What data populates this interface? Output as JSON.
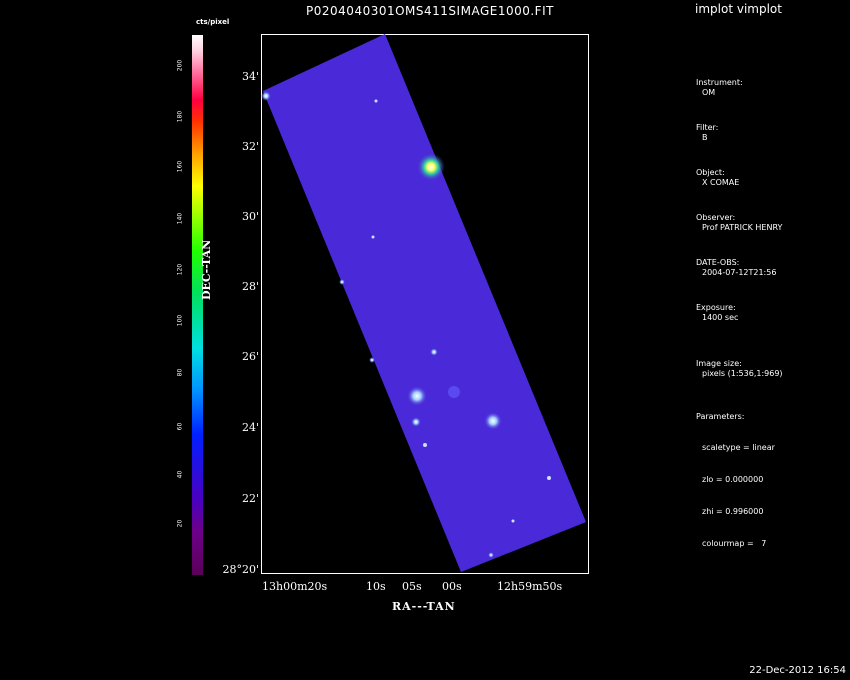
{
  "app": {
    "title": "implot vimplot"
  },
  "plot": {
    "filename": "P0204040301OMS411SIMAGE1000.FIT",
    "xlabel": "RA---TAN",
    "ylabel": "DEC--TAN",
    "colorbar": {
      "unit": "cts/pixel",
      "ticks": [
        "20",
        "40",
        "60",
        "80",
        "100",
        "120",
        "140",
        "160",
        "180",
        "200"
      ]
    },
    "yticks": [
      "28°20'",
      "22'",
      "24'",
      "26'",
      "28'",
      "30'",
      "32'",
      "34'"
    ],
    "xticks": [
      "13h00m20s",
      "10s",
      "05s",
      "00s",
      "12h59m50s"
    ]
  },
  "info": {
    "instrument_label": "Instrument:",
    "instrument": "OM",
    "filter_label": "Filter:",
    "filter": "B",
    "object_label": "Object:",
    "object": "X COMAE",
    "observer_label": "Observer:",
    "observer": "Prof PATRICK HENRY",
    "dateobs_label": "DATE-OBS:",
    "dateobs": "2004-07-12T21:56",
    "exposure_label": "Exposure:",
    "exposure": "1400 sec",
    "imagesize_label": "Image size:",
    "imagesize": "pixels (1:536,1:969)",
    "params_label": "Parameters:",
    "scaletype": "scaletype = linear",
    "zlo": "zlo = 0.000000",
    "zhi": "zhi = 0.996000",
    "colourmap": "colourmap =   7"
  },
  "footer": {
    "date": "22-Dec-2012 16:54"
  },
  "colors": {
    "background": "#000000",
    "image_fill": "#4a2ad8",
    "text": "#ffffff"
  }
}
